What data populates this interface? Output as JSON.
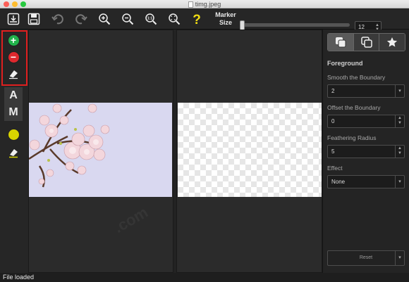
{
  "window": {
    "title": "timg.jpeg"
  },
  "toolbar": {
    "marker_label_line1": "Marker",
    "marker_label_line2": "Size",
    "marker_size_value": "12",
    "icons": [
      "import-icon",
      "save-icon",
      "undo-icon",
      "redo-icon",
      "zoom-in-icon",
      "zoom-out-icon",
      "zoom-actual-icon",
      "zoom-fit-icon",
      "help-icon"
    ]
  },
  "tools": {
    "foreground_letter": "A",
    "mask_letter": "M"
  },
  "sidebar": {
    "section_title": "Foreground",
    "smooth_label": "Smooth the Boundary",
    "smooth_value": "2",
    "offset_label": "Offset the Boundary",
    "offset_value": "0",
    "feather_label": "Feathering Radius",
    "feather_value": "5",
    "effect_label": "Effect",
    "effect_value": "None",
    "reset_label": "Reset"
  },
  "status": {
    "text": "File loaded"
  },
  "colors": {
    "accent_red": "#e01f1f",
    "add_green": "#21b24b",
    "remove_red": "#e0282e",
    "yellow": "#d9d400"
  }
}
